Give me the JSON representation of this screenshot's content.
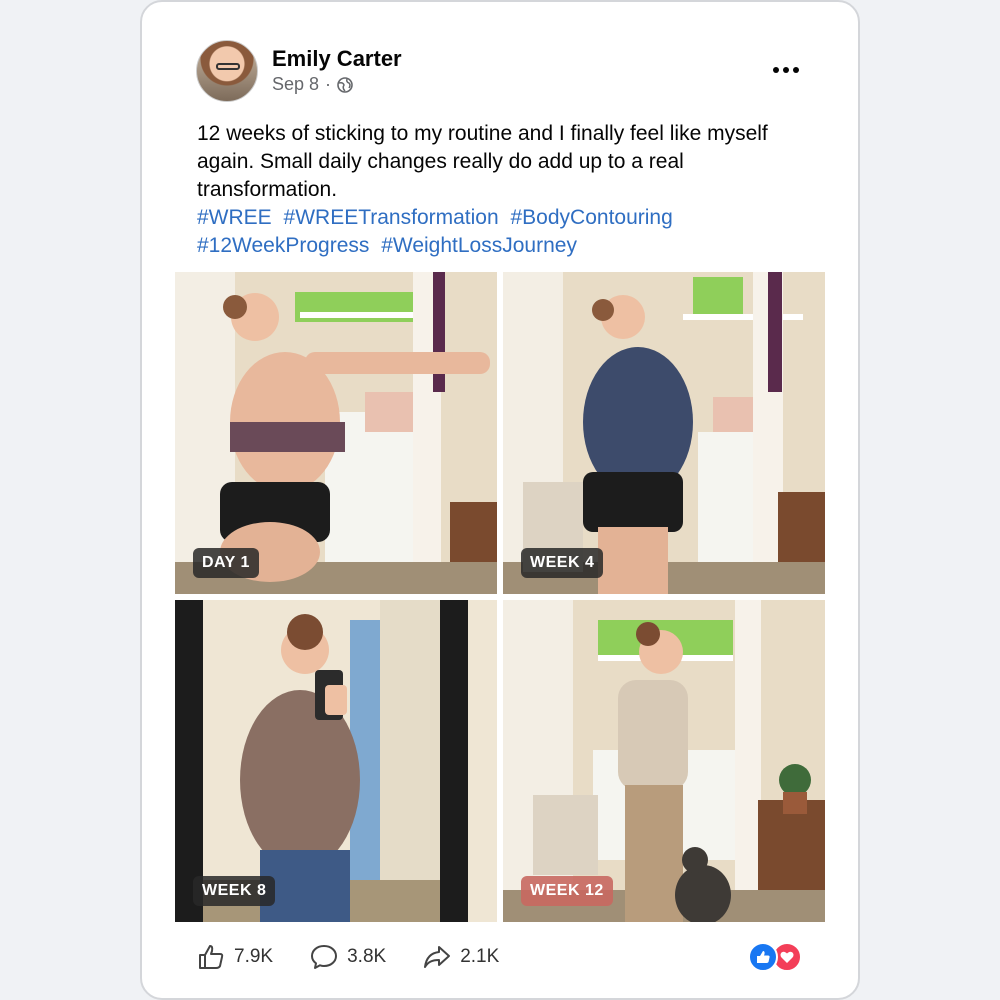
{
  "post": {
    "author": "Emily Carter",
    "date": "Sep 8",
    "separator": "·",
    "privacy_icon": "globe-icon",
    "text": "12 weeks of sticking to my routine and I finally feel like myself again. Small daily changes really do add up to a real transformation.",
    "hashtags": [
      "#WREE",
      "#WREETransformation",
      "#BodyContouring",
      "#12WeekProgress",
      "#WeightLossJourney"
    ]
  },
  "photos": [
    {
      "label": "DAY 1"
    },
    {
      "label": "WEEK 4"
    },
    {
      "label": "WEEK 8"
    },
    {
      "label": "WEEK 12"
    }
  ],
  "stats": {
    "likes": "7.9K",
    "comments": "3.8K",
    "shares": "2.1K"
  },
  "icons": {
    "like": "thumbs-up-icon",
    "comment": "comment-icon",
    "share": "share-icon",
    "reactions": [
      "like-reaction-icon",
      "love-reaction-icon"
    ]
  },
  "colors": {
    "hashtag": "#2f6ec2",
    "like_reaction": "#1877f2",
    "love_reaction": "#f33e58",
    "label_dark": "#282828",
    "label_accent": "#c86860"
  }
}
